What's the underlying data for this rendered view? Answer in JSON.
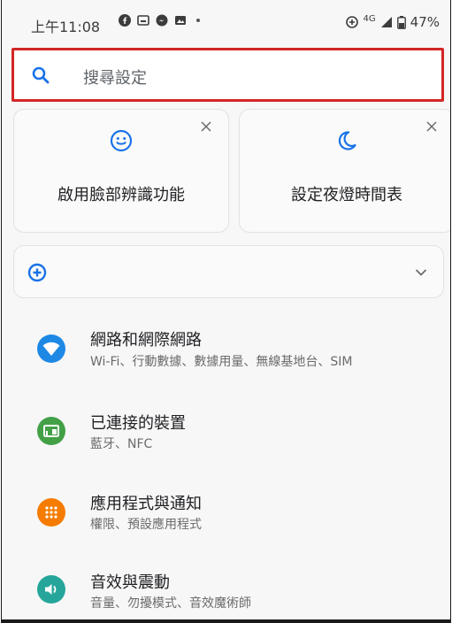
{
  "status_bar": {
    "time": "上午11:08",
    "network": "4G",
    "battery": "47%"
  },
  "search": {
    "placeholder": "搜尋設定"
  },
  "suggestions": [
    {
      "label": "啟用臉部辨識功能",
      "icon": "face-icon"
    },
    {
      "label": "設定夜燈時間表",
      "icon": "moon-icon"
    }
  ],
  "colors": {
    "accent": "#1a73e8",
    "search_highlight": "#d32626",
    "wifi": "#1e88e5",
    "devices": "#43a047",
    "apps": "#f57c00",
    "sound": "#26a69a"
  },
  "settings": [
    {
      "title": "網路和網際網路",
      "subtitle": "Wi-Fi、行動數據、數據用量、無線基地台、SIM",
      "icon": "wifi-icon"
    },
    {
      "title": "已連接的裝置",
      "subtitle": "藍牙、NFC",
      "icon": "devices-icon"
    },
    {
      "title": "應用程式與通知",
      "subtitle": "權限、預設應用程式",
      "icon": "apps-icon"
    },
    {
      "title": "音效與震動",
      "subtitle": "音量、勿擾模式、音效魔術師",
      "icon": "volume-icon"
    }
  ]
}
